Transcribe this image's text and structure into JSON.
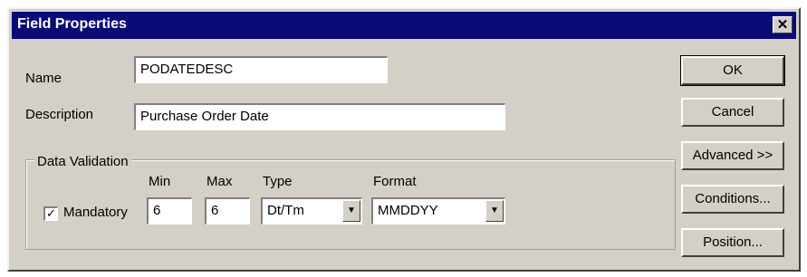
{
  "dialog": {
    "title": "Field Properties",
    "close_glyph": "✕"
  },
  "name": {
    "label": "Name",
    "value": "PODATEDESC"
  },
  "description": {
    "label": "Description",
    "value": "Purchase Order Date"
  },
  "data_validation": {
    "title": "Data Validation",
    "mandatory": {
      "label": "Mandatory",
      "checked": true,
      "glyph": "✓"
    },
    "min": {
      "label": "Min",
      "value": "6"
    },
    "max": {
      "label": "Max",
      "value": "6"
    },
    "type": {
      "label": "Type",
      "value": "Dt/Tm"
    },
    "format": {
      "label": "Format",
      "value": "MMDDYY"
    },
    "dropdown_glyph": "▼"
  },
  "buttons": {
    "ok": "OK",
    "cancel": "Cancel",
    "advanced": "Advanced >>",
    "conditions": "Conditions...",
    "position": "Position..."
  }
}
